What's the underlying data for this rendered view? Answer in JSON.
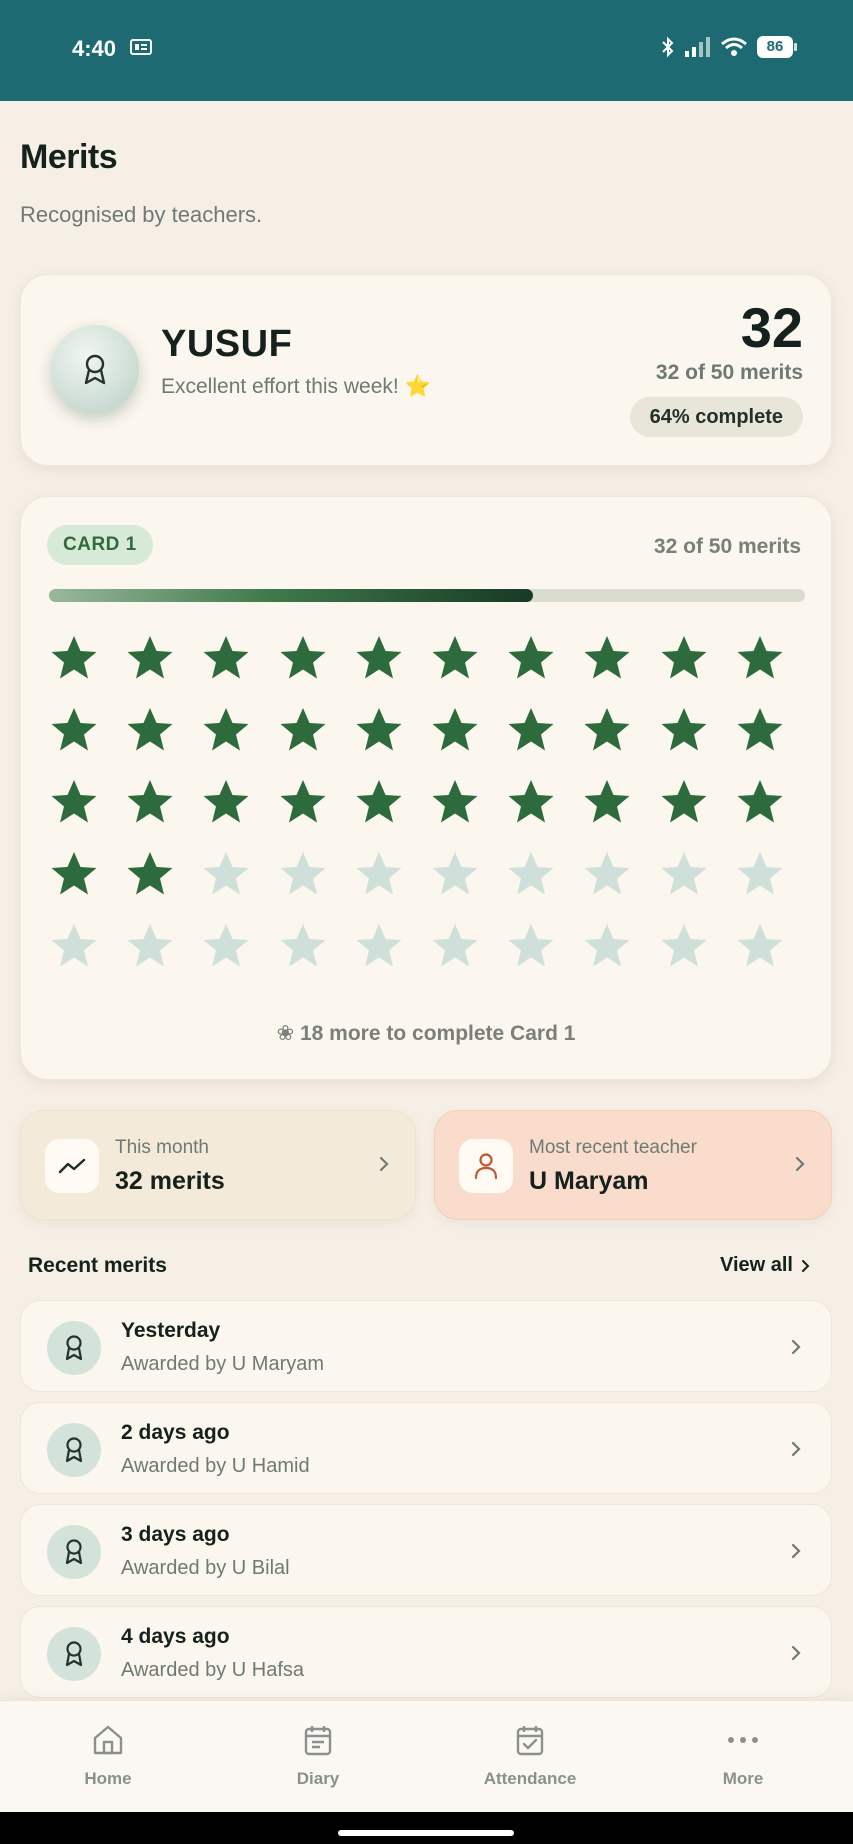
{
  "status_bar": {
    "time": "4:40",
    "battery": "86"
  },
  "header": {
    "title": "Merits",
    "subtitle": "Recognised by teachers."
  },
  "profile": {
    "name": "YUSUF",
    "note": "Excellent effort this week! ⭐",
    "merit_count": "32",
    "merit_of": "32 of 50 merits",
    "complete_label": "64% complete",
    "complete_fraction": 0.64
  },
  "merit_card": {
    "label": "CARD 1",
    "of_label": "32 of 50 merits",
    "earned": 32,
    "total": 50,
    "footer": "❀ 18 more to complete Card 1",
    "colors": {
      "earned": "#2d6a3c",
      "empty": "#cfe0da"
    }
  },
  "tiles": {
    "month": {
      "label": "This month",
      "value": "32 merits"
    },
    "teacher": {
      "label": "Most recent teacher",
      "value": "U Maryam"
    }
  },
  "recent": {
    "title": "Recent merits",
    "view_all": "View all",
    "items": [
      {
        "title": "Yesterday",
        "sub": "Awarded by U Maryam"
      },
      {
        "title": "2 days ago",
        "sub": "Awarded by U Hamid"
      },
      {
        "title": "3 days ago",
        "sub": "Awarded by U Bilal"
      },
      {
        "title": "4 days ago",
        "sub": "Awarded by U Hafsa"
      }
    ]
  },
  "tabs": [
    {
      "label": "Home",
      "icon": "home-icon"
    },
    {
      "label": "Diary",
      "icon": "diary-icon"
    },
    {
      "label": "Attendance",
      "icon": "attendance-icon"
    },
    {
      "label": "More",
      "icon": "more-icon"
    }
  ]
}
